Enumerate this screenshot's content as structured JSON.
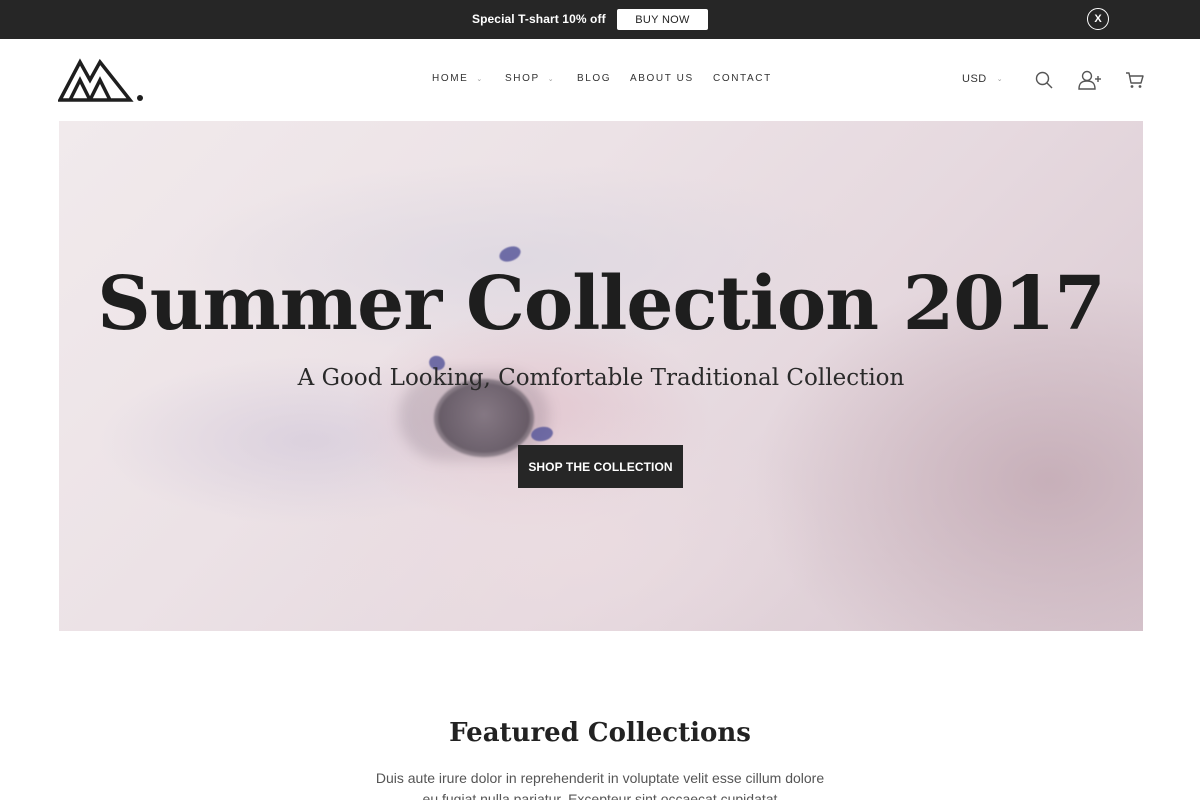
{
  "promo": {
    "text": "Special T-shart 10% off",
    "button_label": "BUY NOW",
    "close_label": "X"
  },
  "header": {
    "logo_icon": "mountain-logo",
    "nav": [
      {
        "label": "HOME",
        "has_dropdown": true
      },
      {
        "label": "SHOP",
        "has_dropdown": true
      },
      {
        "label": "BLOG",
        "has_dropdown": false
      },
      {
        "label": "ABOUT US",
        "has_dropdown": false
      },
      {
        "label": "CONTACT",
        "has_dropdown": false
      }
    ],
    "currency": "USD",
    "icons": [
      "search-icon",
      "add-user-icon",
      "cart-icon"
    ]
  },
  "hero": {
    "title": "Summer Collection 2017",
    "subtitle": "A Good Looking, Comfortable Traditional Collection",
    "cta_label": "SHOP THE COLLECTION"
  },
  "featured": {
    "title": "Featured Collections",
    "description": "Duis aute irure dolor in reprehenderit in voluptate velit esse cillum dolore eu fugiat nulla pariatur. Excepteur sint occaecat cupidatat"
  },
  "colors": {
    "dark": "#262626",
    "text": "#222222",
    "muted": "#555555"
  }
}
